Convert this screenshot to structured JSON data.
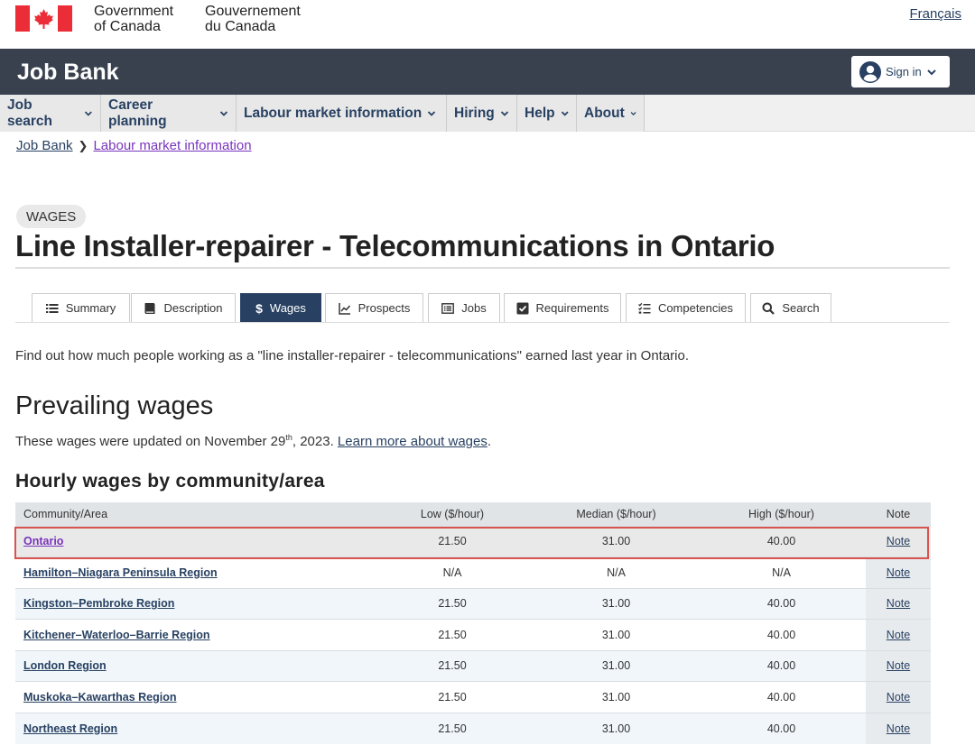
{
  "gov": {
    "en_line1": "Government",
    "en_line2": "of Canada",
    "fr_line1": "Gouvernement",
    "fr_line2": "du Canada",
    "lang_toggle": "Français"
  },
  "jobbank": {
    "title": "Job Bank",
    "signin_label": "Sign in"
  },
  "nav": {
    "items": [
      {
        "label": "Job search"
      },
      {
        "label": "Career planning"
      },
      {
        "label": "Labour market information"
      },
      {
        "label": "Hiring"
      },
      {
        "label": "Help"
      },
      {
        "label": "About"
      }
    ]
  },
  "breadcrumb": {
    "items": [
      "Job Bank",
      "Labour market information"
    ]
  },
  "page": {
    "tag": "WAGES",
    "title": "Line Installer-repairer - Telecommunications in Ontario",
    "intro": "Find out how much people working as a \"line installer-repairer - telecommunications\" earned last year in Ontario.",
    "section_title": "Prevailing wages",
    "updated_prefix": "These wages were updated on November 29",
    "updated_sup": "th",
    "updated_suffix": ", 2023. ",
    "updated_link": "Learn more about wages",
    "updated_end": ".",
    "table_title": "Hourly wages by community/area"
  },
  "tabs": [
    {
      "label": "Summary",
      "icon": "list-icon"
    },
    {
      "label": "Description",
      "icon": "book-icon"
    },
    {
      "label": "Wages",
      "icon": "dollar-icon",
      "active": true
    },
    {
      "label": "Prospects",
      "icon": "chart-line-icon"
    },
    {
      "label": "Jobs",
      "icon": "list-alt-icon"
    },
    {
      "label": "Requirements",
      "icon": "checkbox-icon"
    },
    {
      "label": "Competencies",
      "icon": "tasks-icon"
    },
    {
      "label": "Search",
      "icon": "search-icon"
    }
  ],
  "table": {
    "headers": [
      "Community/Area",
      "Low ($/hour)",
      "Median ($/hour)",
      "High ($/hour)",
      "Note"
    ],
    "rows": [
      {
        "area": "Ontario",
        "low": "21.50",
        "median": "31.00",
        "high": "40.00",
        "note": "Note"
      },
      {
        "area": "Hamilton–Niagara Peninsula Region",
        "low": "N/A",
        "median": "N/A",
        "high": "N/A",
        "note": "Note"
      },
      {
        "area": "Kingston–Pembroke Region",
        "low": "21.50",
        "median": "31.00",
        "high": "40.00",
        "note": "Note"
      },
      {
        "area": "Kitchener–Waterloo–Barrie Region",
        "low": "21.50",
        "median": "31.00",
        "high": "40.00",
        "note": "Note"
      },
      {
        "area": "London Region",
        "low": "21.50",
        "median": "31.00",
        "high": "40.00",
        "note": "Note"
      },
      {
        "area": "Muskoka–Kawarthas Region",
        "low": "21.50",
        "median": "31.00",
        "high": "40.00",
        "note": "Note"
      },
      {
        "area": "Northeast Region",
        "low": "21.50",
        "median": "31.00",
        "high": "40.00",
        "note": "Note"
      }
    ]
  },
  "colors": {
    "flag_red": "#eb2d37",
    "jobbank_bar": "#38414d",
    "link": "#284162",
    "visited_link": "#7834bc",
    "highlight_border": "#d9534f"
  }
}
